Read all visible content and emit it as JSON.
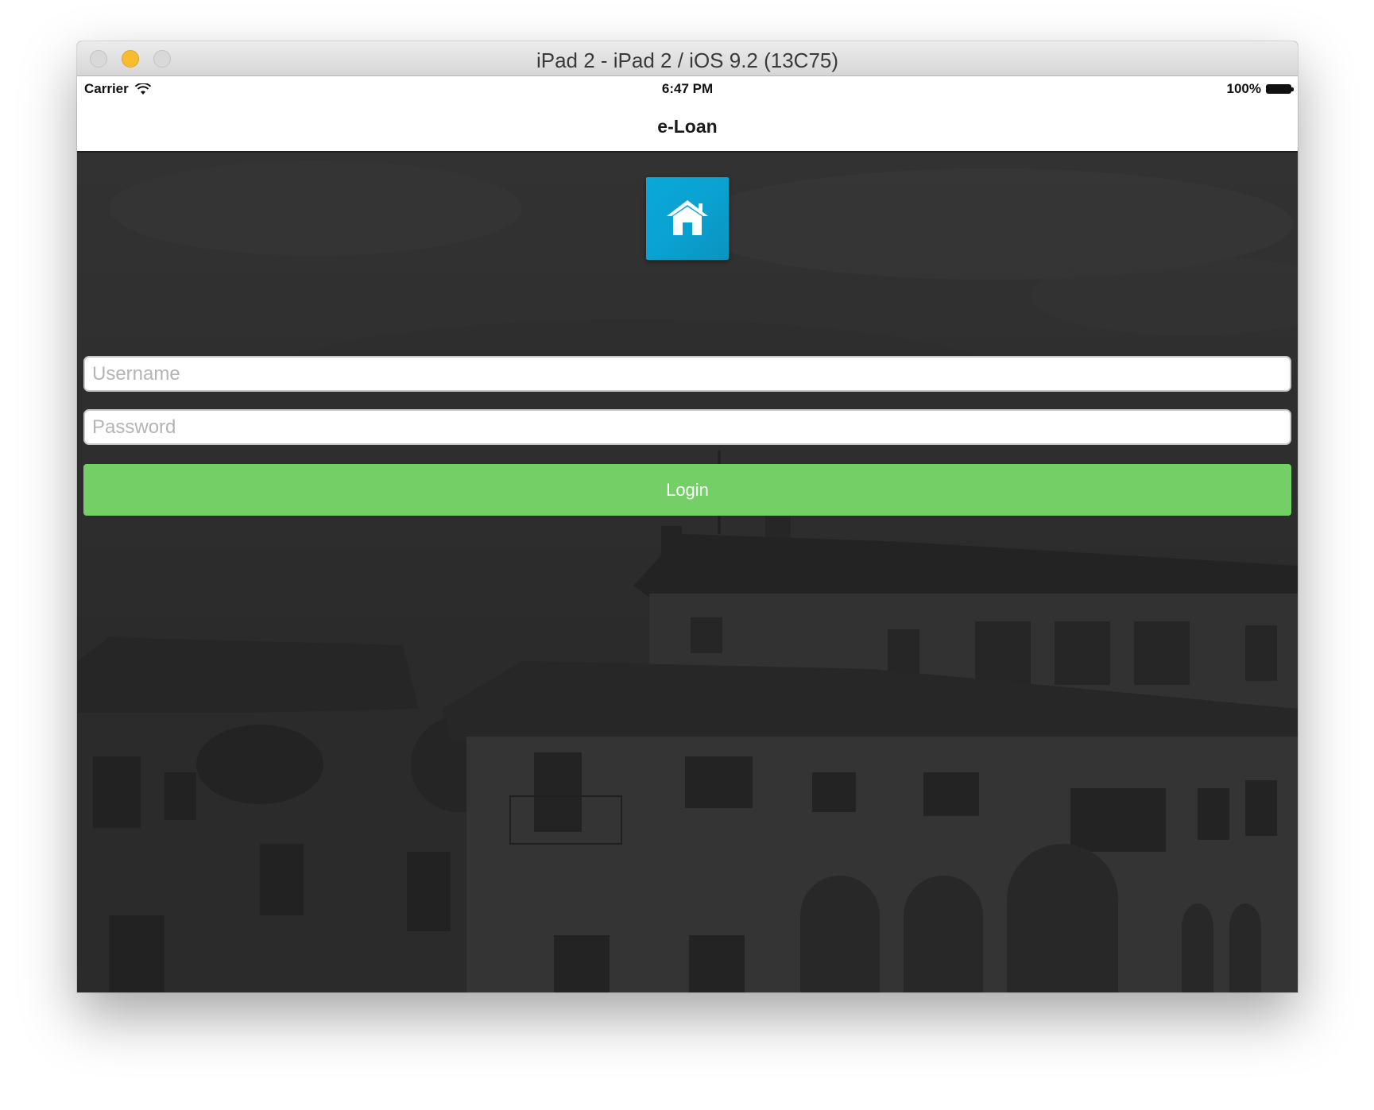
{
  "window": {
    "title": "iPad 2 - iPad 2 / iOS 9.2 (13C75)",
    "controls": [
      "close",
      "minimize",
      "zoom"
    ]
  },
  "statusbar": {
    "carrier": "Carrier",
    "time": "6:47 PM",
    "battery": "100%",
    "icons": [
      "wifi-icon",
      "battery-icon"
    ]
  },
  "navbar": {
    "title": "e-Loan"
  },
  "login": {
    "logo_icon": "house-icon",
    "username_placeholder": "Username",
    "username_value": "",
    "password_placeholder": "Password",
    "password_value": "",
    "button_label": "Login"
  },
  "colors": {
    "logo_bg": "#0aa8d8",
    "login_button": "#74cf66",
    "background": "#2f2f2f"
  }
}
